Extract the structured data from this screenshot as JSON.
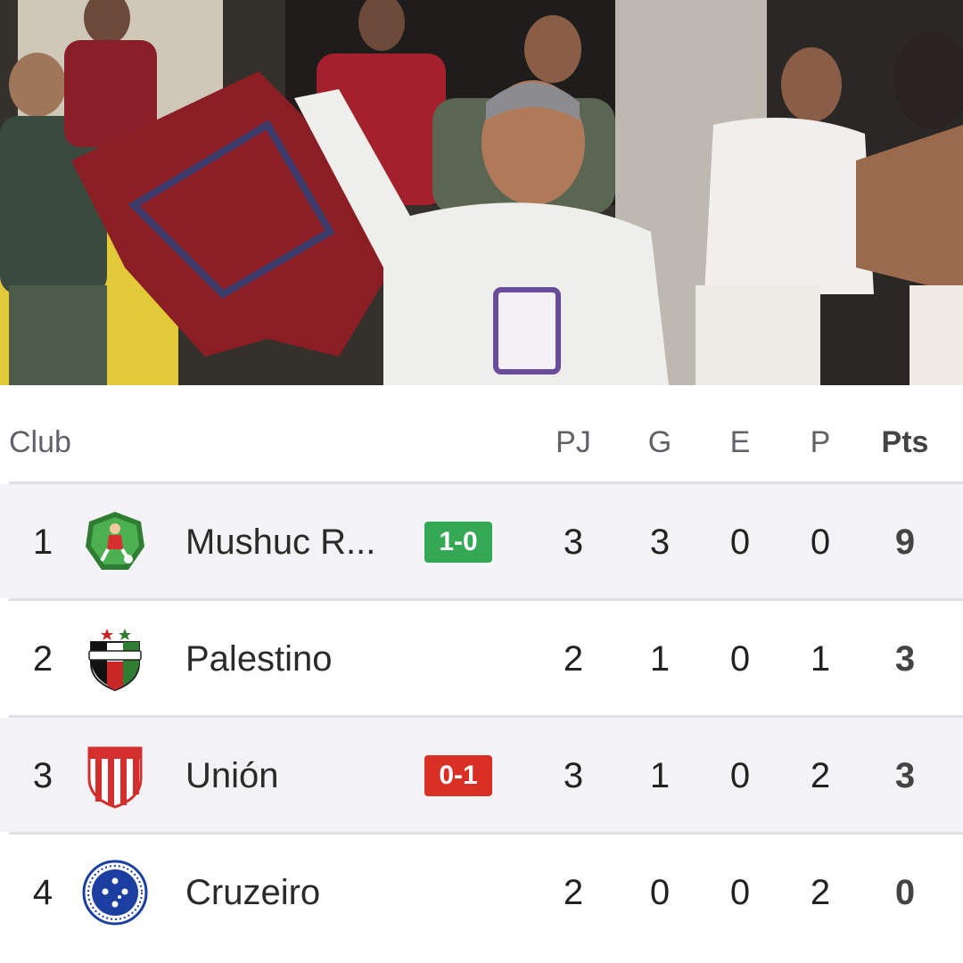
{
  "colors": {
    "win_badge": "#34a853",
    "loss_badge": "#d93025",
    "row_shade": "#f3f3f5",
    "divider": "#e0e0e4"
  },
  "header": {
    "club": "Club",
    "pj": "PJ",
    "g": "G",
    "e": "E",
    "p": "P",
    "pts": "Pts"
  },
  "rows": [
    {
      "pos": "1",
      "club": "Mushuc R...",
      "icon": "mushuc-runa-crest-icon",
      "result": "1-0",
      "result_type": "win",
      "pj": "3",
      "g": "3",
      "e": "0",
      "p": "0",
      "pts": "9"
    },
    {
      "pos": "2",
      "club": "Palestino",
      "icon": "palestino-crest-icon",
      "result": "",
      "result_type": "",
      "pj": "2",
      "g": "1",
      "e": "0",
      "p": "1",
      "pts": "3"
    },
    {
      "pos": "3",
      "club": "Unión",
      "icon": "union-crest-icon",
      "result": "0-1",
      "result_type": "loss",
      "pj": "3",
      "g": "1",
      "e": "0",
      "p": "2",
      "pts": "3"
    },
    {
      "pos": "4",
      "club": "Cruzeiro",
      "icon": "cruzeiro-crest-icon",
      "result": "",
      "result_type": "",
      "pj": "2",
      "g": "0",
      "e": "0",
      "p": "2",
      "pts": "0"
    }
  ]
}
